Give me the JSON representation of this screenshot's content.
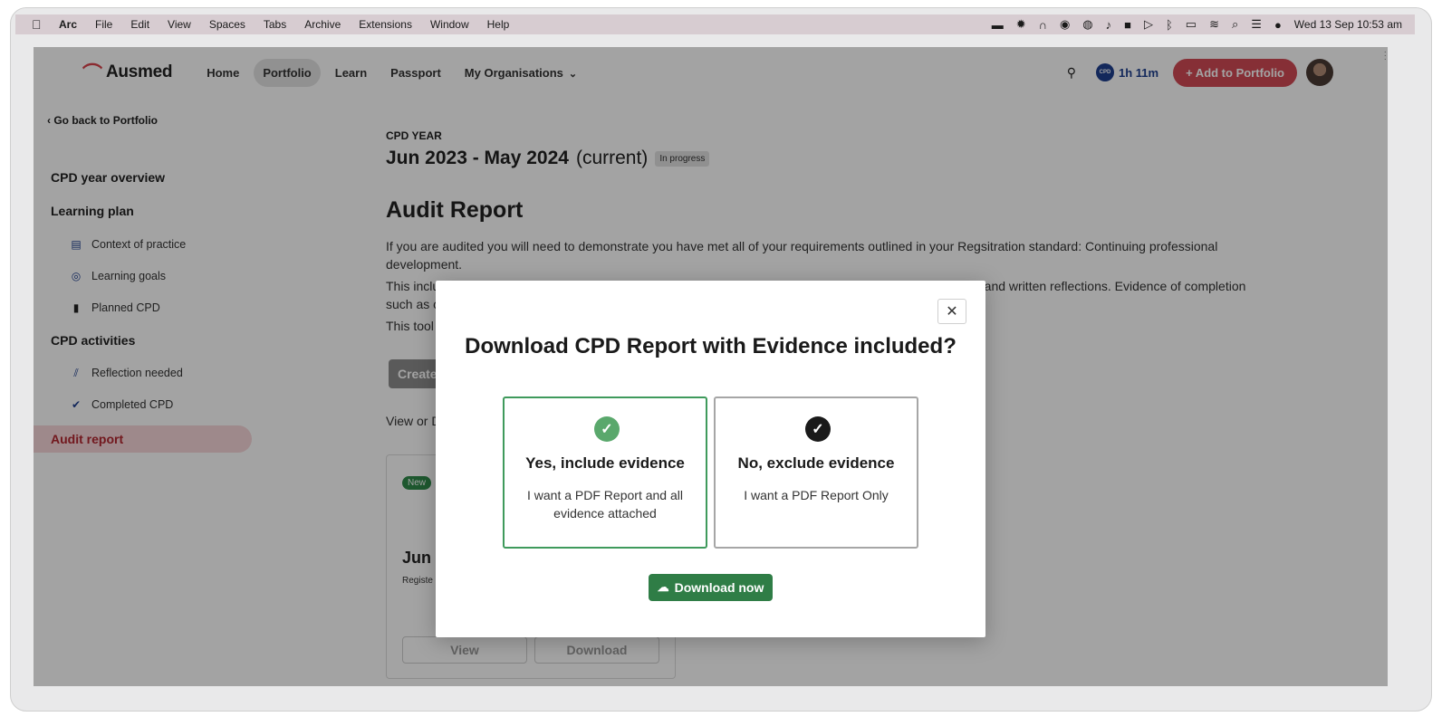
{
  "menubar": {
    "app_name": "Arc",
    "items": [
      "File",
      "Edit",
      "View",
      "Spaces",
      "Tabs",
      "Archive",
      "Extensions",
      "Window",
      "Help"
    ],
    "clock": "Wed 13 Sep  10:53 am"
  },
  "nav": {
    "logo": "Ausmed",
    "links": [
      "Home",
      "Portfolio",
      "Learn",
      "Passport",
      "My Organisations"
    ],
    "cpd_time": "1h 11m",
    "cpd_badge": "CPD",
    "add_button": "+ Add to Portfolio"
  },
  "sidebar": {
    "back": "Go back to Portfolio",
    "overview": "CPD year overview",
    "learning_plan": "Learning plan",
    "learning_items": [
      "Context of practice",
      "Learning goals",
      "Planned CPD"
    ],
    "activities": "CPD activities",
    "activity_items": [
      "Reflection needed",
      "Completed CPD"
    ],
    "audit": "Audit report"
  },
  "main": {
    "eyebrow": "CPD YEAR",
    "year": "Jun 2023 - May 2024",
    "current": "(current)",
    "status": "In progress",
    "heading": "Audit Report",
    "para1": "If you are audited you will need to demonstrate you have met all of your requirements outlined in your Regsitration standard: Continuing professional development.",
    "para2_start": "This inclu",
    "para2_end": "d and written reflections. Evidence of completion",
    "para2_line2": "such as c",
    "para3": "This tool",
    "create": "Create",
    "view_or": "View or D",
    "card_new": "New",
    "card_title": "Jun 2",
    "card_sub": "Registe",
    "card_view": "View",
    "card_download": "Download"
  },
  "modal": {
    "title": "Download CPD Report with Evidence included?",
    "options": [
      {
        "title": "Yes, include evidence",
        "desc": "I want a PDF Report and all evidence attached",
        "selected": true
      },
      {
        "title": "No, exclude evidence",
        "desc": "I want a PDF Report Only",
        "selected": false
      }
    ],
    "download": "Download now",
    "accent": "#3f9a5c"
  }
}
